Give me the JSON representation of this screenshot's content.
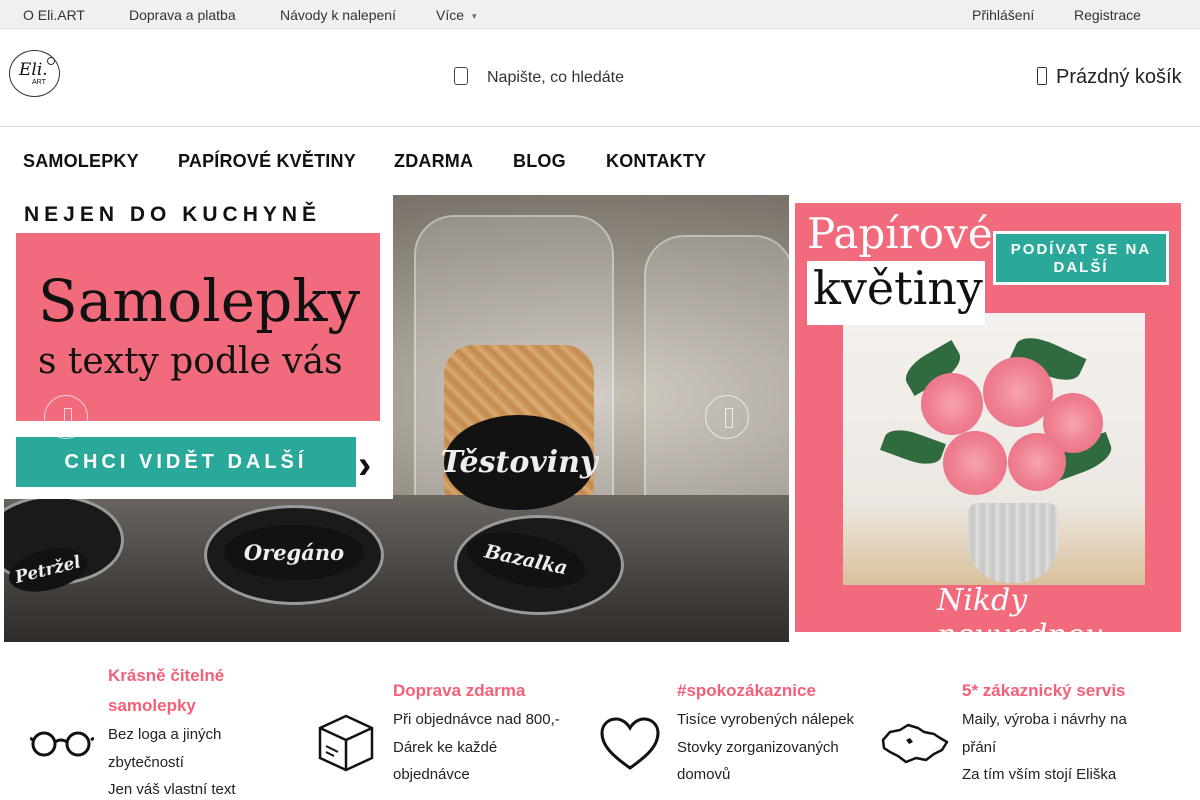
{
  "topbar": {
    "links": [
      "O Eli.ART",
      "Doprava a platba",
      "Návody k nalepení",
      "Více"
    ],
    "login": "Přihlášení",
    "register": "Registrace"
  },
  "header": {
    "logo_text": "Eli.",
    "logo_sub": "ART",
    "search_placeholder": "Napište, co hledáte",
    "cart_label": "Prázdný košík"
  },
  "nav": [
    "SAMOLEPKY",
    "PAPÍROVÉ KVĚTINY",
    "ZDARMA",
    "BLOG",
    "KONTAKTY"
  ],
  "banner_left": {
    "headline": "NEJEN DO KUCHYNĚ",
    "title": "Samolepky",
    "subtitle": "s texty podle vás",
    "cta": "CHCI VIDĚT DALŠÍ",
    "jar_labels": [
      "Těstoviny",
      "Oregáno",
      "Bazalka",
      "Petržel"
    ]
  },
  "banner_right": {
    "title_top": "Papírové",
    "title_bottom": "květiny",
    "cta": "PODÍVAT SE NA DALŠÍ",
    "script": "Nikdy neuvadnou"
  },
  "features": [
    {
      "title_line1": "Krásně čitelné",
      "title_line2": "samolepky",
      "lines": [
        "Bez loga a jiných",
        "zbytečností",
        "Jen váš vlastní text"
      ],
      "icon": "glasses-icon"
    },
    {
      "title_line1": "Doprava zdarma",
      "title_line2": "",
      "lines": [
        "Při objednávce nad 800,-",
        "Dárek ke každé",
        "objednávce"
      ],
      "icon": "box-icon"
    },
    {
      "title_line1": "#spokozákaznice",
      "title_line2": "",
      "lines": [
        "Tisíce vyrobených nálepek",
        "Stovky zorganizovaných",
        "domovů"
      ],
      "icon": "heart-icon"
    },
    {
      "title_line1": "5* zákaznický servis",
      "title_line2": "",
      "lines": [
        "Maily, výroba i návrhy na",
        "přání",
        "Za tím vším stojí Eliška"
      ],
      "icon": "czech-map-icon"
    }
  ],
  "colors": {
    "accent_pink": "#f26b7d",
    "teal": "#2aa89a",
    "feature_title": "#f2607a"
  }
}
